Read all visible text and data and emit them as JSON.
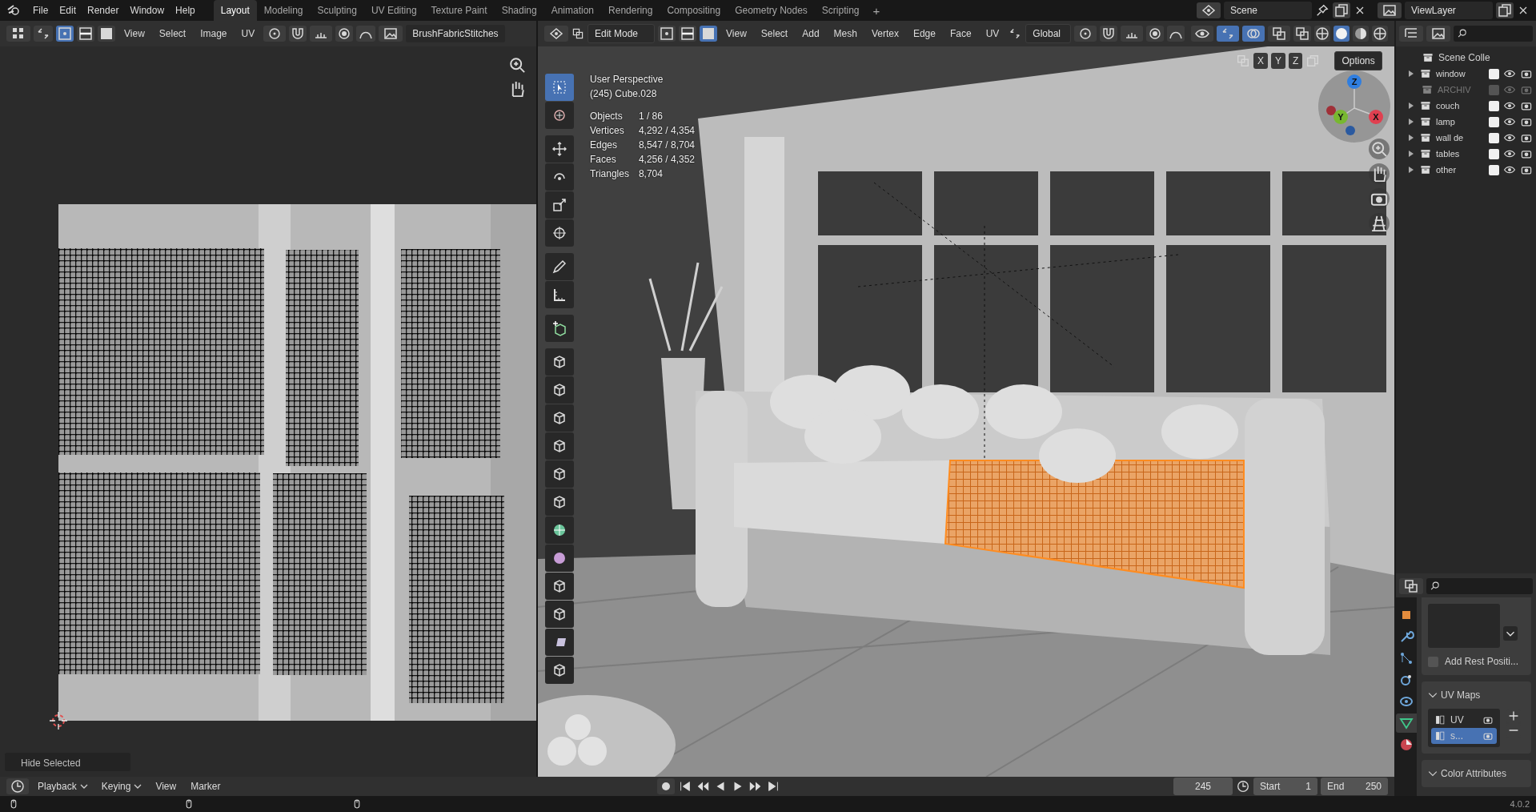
{
  "topbar": {
    "menus": [
      "File",
      "Edit",
      "Render",
      "Window",
      "Help"
    ],
    "workspaces": [
      {
        "label": "Layout",
        "selected": true
      },
      {
        "label": "Modeling",
        "selected": false
      },
      {
        "label": "Sculpting",
        "selected": false
      },
      {
        "label": "UV Editing",
        "selected": false
      },
      {
        "label": "Texture Paint",
        "selected": false
      },
      {
        "label": "Shading",
        "selected": false
      },
      {
        "label": "Animation",
        "selected": false
      },
      {
        "label": "Rendering",
        "selected": false
      },
      {
        "label": "Compositing",
        "selected": false
      },
      {
        "label": "Geometry Nodes",
        "selected": false
      },
      {
        "label": "Scripting",
        "selected": false
      }
    ],
    "add_tab": "+",
    "scene": "Scene",
    "view_layer": "ViewLayer"
  },
  "uv_editor": {
    "menus": [
      "View",
      "Select",
      "Image",
      "UV"
    ],
    "image_name": "BrushFabricStitches",
    "last_operator": "Hide Selected"
  },
  "viewport": {
    "mode": "Edit Mode",
    "menus": [
      "View",
      "Select",
      "Add",
      "Mesh",
      "Vertex",
      "Edge",
      "Face",
      "UV"
    ],
    "orientation": "Global",
    "mirror_axes": [
      "X",
      "Y",
      "Z"
    ],
    "options": "Options",
    "info": {
      "view": "User Perspective",
      "object": "(245) Cube.028",
      "stats": [
        {
          "label": "Objects",
          "value": "1 / 86"
        },
        {
          "label": "Vertices",
          "value": "4,292 / 4,354"
        },
        {
          "label": "Edges",
          "value": "8,547 / 8,704"
        },
        {
          "label": "Faces",
          "value": "4,256 / 4,352"
        },
        {
          "label": "Triangles",
          "value": "8,704"
        }
      ]
    },
    "gizmo_axes": [
      "Z",
      "Y",
      "X"
    ],
    "tool_groups": [
      [
        {
          "kind": "select",
          "selected": true
        },
        {
          "kind": "cursor",
          "selected": false
        }
      ],
      [
        {
          "kind": "move",
          "selected": false
        },
        {
          "kind": "rotate",
          "selected": false
        },
        {
          "kind": "scale",
          "selected": false
        },
        {
          "kind": "transform",
          "selected": false
        }
      ],
      [
        {
          "kind": "annotate",
          "selected": false
        },
        {
          "kind": "measure",
          "selected": false
        }
      ],
      [
        {
          "kind": "add",
          "selected": false
        }
      ],
      [
        {
          "kind": "extrude",
          "selected": false
        },
        {
          "kind": "inset",
          "selected": false
        },
        {
          "kind": "bevel",
          "selected": false
        },
        {
          "kind": "loopcut",
          "selected": false
        },
        {
          "kind": "knife",
          "selected": false
        },
        {
          "kind": "polybuild",
          "selected": false
        },
        {
          "kind": "spin",
          "selected": false
        },
        {
          "kind": "smooth",
          "selected": false
        },
        {
          "kind": "slide",
          "selected": false
        },
        {
          "kind": "shrink",
          "selected": false
        },
        {
          "kind": "shear",
          "selected": false
        },
        {
          "kind": "rip",
          "selected": false
        }
      ]
    ]
  },
  "outliner": {
    "root": "Scene Colle",
    "items": [
      {
        "label": "window",
        "checked": true,
        "expandable": true
      },
      {
        "label": "ARCHIV",
        "checked": false,
        "expandable": false
      },
      {
        "label": "couch",
        "checked": true,
        "expandable": true
      },
      {
        "label": "lamp",
        "checked": true,
        "expandable": true
      },
      {
        "label": "wall de",
        "checked": true,
        "expandable": true
      },
      {
        "label": "tables",
        "checked": true,
        "expandable": true
      },
      {
        "label": "other",
        "checked": true,
        "expandable": true
      }
    ]
  },
  "properties": {
    "tabs": [
      {
        "kind": "object",
        "selected": false
      },
      {
        "kind": "modifier",
        "selected": false
      },
      {
        "kind": "particles",
        "selected": false
      },
      {
        "kind": "physics",
        "selected": false
      },
      {
        "kind": "constraints",
        "selected": false
      },
      {
        "kind": "data",
        "selected": true
      },
      {
        "kind": "material",
        "selected": false
      }
    ],
    "add_rest_position": {
      "label": "Add Rest Positi...",
      "checked": false
    },
    "panels": [
      {
        "title": "UV Maps",
        "expanded": true,
        "items": [
          {
            "label": "UV",
            "selected": false
          },
          {
            "label": "s...",
            "selected": true
          }
        ]
      },
      {
        "title": "Color Attributes",
        "expanded": true
      }
    ]
  },
  "timeline": {
    "menus": [
      {
        "label": "Playback",
        "dropdown": true
      },
      {
        "label": "Keying",
        "dropdown": true
      },
      {
        "label": "View",
        "dropdown": false
      },
      {
        "label": "Marker",
        "dropdown": false
      }
    ],
    "current_frame": "245",
    "start_label": "Start",
    "start": "1",
    "end_label": "End",
    "end": "250"
  },
  "status_bar": {
    "version": "4.0.2"
  }
}
